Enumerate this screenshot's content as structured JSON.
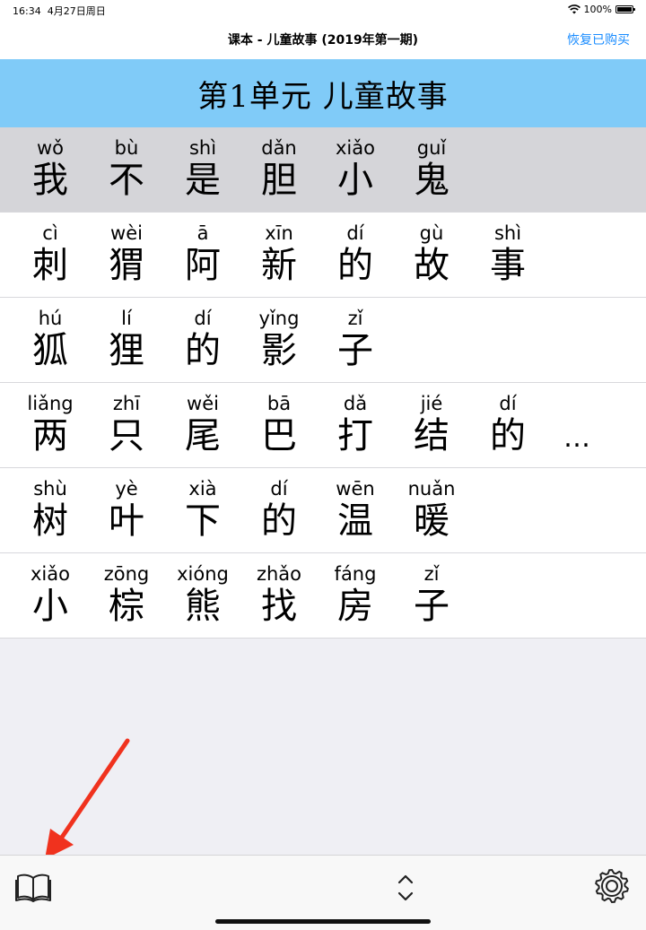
{
  "status_bar": {
    "time": "16:34",
    "date": "4月27日周日",
    "battery": "100%",
    "wifi_icon": "wifi-icon",
    "battery_icon": "battery-icon"
  },
  "nav": {
    "title": "课本 - 儿童故事 (2019年第一期)",
    "restore_label": "恢复已购买"
  },
  "unit_title": "第1单元 儿童故事",
  "lines": [
    {
      "selected": true,
      "words": [
        {
          "py": "wǒ",
          "hz": "我"
        },
        {
          "py": "bù",
          "hz": "不"
        },
        {
          "py": "shì",
          "hz": "是"
        },
        {
          "py": "dǎn",
          "hz": "胆"
        },
        {
          "py": "xiǎo",
          "hz": "小"
        },
        {
          "py": "guǐ",
          "hz": "鬼"
        }
      ]
    },
    {
      "selected": false,
      "words": [
        {
          "py": "cì",
          "hz": "刺"
        },
        {
          "py": "wèi",
          "hz": "猬"
        },
        {
          "py": "ā",
          "hz": "阿"
        },
        {
          "py": "xīn",
          "hz": "新"
        },
        {
          "py": "dí",
          "hz": "的"
        },
        {
          "py": "gù",
          "hz": "故"
        },
        {
          "py": "shì",
          "hz": "事"
        }
      ]
    },
    {
      "selected": false,
      "words": [
        {
          "py": "hú",
          "hz": "狐"
        },
        {
          "py": "lí",
          "hz": "狸"
        },
        {
          "py": "dí",
          "hz": "的"
        },
        {
          "py": "yǐng",
          "hz": "影"
        },
        {
          "py": "zǐ",
          "hz": "子"
        }
      ]
    },
    {
      "selected": false,
      "ellipsis": "…",
      "words": [
        {
          "py": "liǎng",
          "hz": "两"
        },
        {
          "py": "zhī",
          "hz": "只"
        },
        {
          "py": "wěi",
          "hz": "尾"
        },
        {
          "py": "bā",
          "hz": "巴"
        },
        {
          "py": "dǎ",
          "hz": "打"
        },
        {
          "py": "jié",
          "hz": "结"
        },
        {
          "py": "dí",
          "hz": "的"
        }
      ]
    },
    {
      "selected": false,
      "words": [
        {
          "py": "shù",
          "hz": "树"
        },
        {
          "py": "yè",
          "hz": "叶"
        },
        {
          "py": "xià",
          "hz": "下"
        },
        {
          "py": "dí",
          "hz": "的"
        },
        {
          "py": "wēn",
          "hz": "温"
        },
        {
          "py": "nuǎn",
          "hz": "暖"
        }
      ]
    },
    {
      "selected": false,
      "words": [
        {
          "py": "xiǎo",
          "hz": "小"
        },
        {
          "py": "zōng",
          "hz": "棕"
        },
        {
          "py": "xióng",
          "hz": "熊"
        },
        {
          "py": "zhǎo",
          "hz": "找"
        },
        {
          "py": "fáng",
          "hz": "房"
        },
        {
          "py": "zǐ",
          "hz": "子"
        }
      ]
    }
  ],
  "toolbar": {
    "book_icon": "book-icon",
    "updown_icon": "chevron-up-down-icon",
    "gear_icon": "gear-icon"
  },
  "annotation": {
    "arrow_color": "#f0321e"
  },
  "colors": {
    "header_bg": "#80cbf8",
    "selected_row_bg": "#d5d5d9",
    "accent": "#1a8cff"
  }
}
